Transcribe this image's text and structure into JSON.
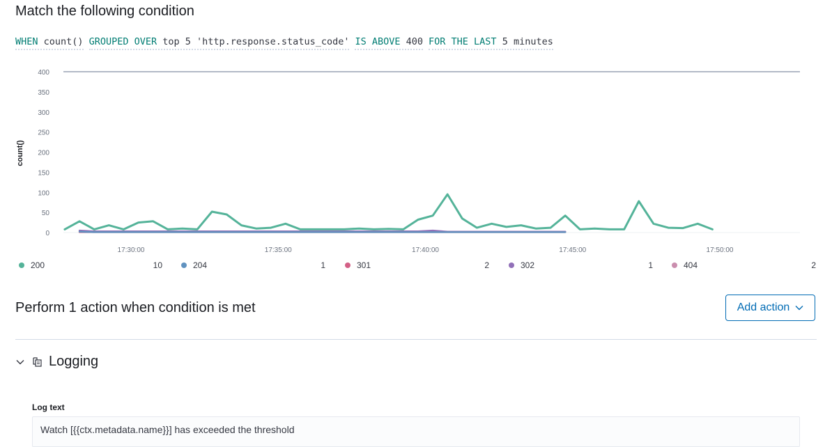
{
  "section_title": "Match the following condition",
  "expression": [
    {
      "keyword": "WHEN",
      "value": "count()"
    },
    {
      "keyword": "GROUPED OVER",
      "value": "top 5 'http.response.status_code'"
    },
    {
      "keyword": "IS ABOVE",
      "value": "400"
    },
    {
      "keyword": "FOR THE LAST",
      "value": "5 minutes"
    }
  ],
  "chart_data": {
    "type": "line",
    "ylabel": "count()",
    "xlabel": "",
    "ylim": [
      0,
      400
    ],
    "yticks": [
      "400",
      "350",
      "300",
      "250",
      "200",
      "150",
      "100",
      "50",
      "0"
    ],
    "xticks": [
      "17:30:00",
      "17:35:00",
      "17:40:00",
      "17:45:00",
      "17:50:00"
    ],
    "threshold": 400,
    "x": [
      "17:27:45",
      "17:28:15",
      "17:28:45",
      "17:29:15",
      "17:29:45",
      "17:30:15",
      "17:30:45",
      "17:31:15",
      "17:31:45",
      "17:32:15",
      "17:32:45",
      "17:33:15",
      "17:33:45",
      "17:34:15",
      "17:34:45",
      "17:35:15",
      "17:35:45",
      "17:36:15",
      "17:36:45",
      "17:37:15",
      "17:37:45",
      "17:38:15",
      "17:38:45",
      "17:39:15",
      "17:39:45",
      "17:40:15",
      "17:40:45",
      "17:41:15",
      "17:41:45",
      "17:42:15",
      "17:42:45",
      "17:43:15",
      "17:43:45",
      "17:44:15",
      "17:44:45",
      "17:45:15",
      "17:45:45",
      "17:46:15",
      "17:46:45",
      "17:47:15",
      "17:47:45",
      "17:48:15",
      "17:48:45",
      "17:49:15",
      "17:49:45",
      "17:50:15"
    ],
    "series": [
      {
        "name": "200",
        "color": "#54b399",
        "count": "10",
        "values": [
          8,
          28,
          8,
          18,
          8,
          25,
          28,
          8,
          10,
          8,
          52,
          45,
          18,
          10,
          12,
          22,
          8,
          8,
          8,
          8,
          10,
          8,
          9,
          8,
          32,
          42,
          95,
          35,
          12,
          22,
          14,
          18,
          10,
          12,
          42,
          8,
          10,
          8,
          8,
          78,
          22,
          12,
          11,
          22,
          8,
          null
        ]
      },
      {
        "name": "204",
        "color": "#6092c0",
        "count": "1",
        "values": [
          null,
          2,
          1,
          1,
          1,
          1,
          1,
          1,
          1,
          1,
          1,
          1,
          1,
          1,
          1,
          1,
          1,
          1,
          1,
          1,
          1,
          1,
          1,
          1,
          1,
          1,
          1,
          1,
          1,
          1,
          1,
          1,
          1,
          1,
          1,
          null,
          null,
          null,
          null,
          null,
          null,
          null,
          null,
          null,
          null,
          null
        ]
      },
      {
        "name": "301",
        "color": "#d36086",
        "count": "2",
        "values": [
          null,
          1,
          1,
          1,
          1,
          1,
          1,
          1,
          1,
          1,
          1,
          1,
          1,
          1,
          1,
          1,
          1,
          1,
          1,
          1,
          1,
          1,
          1,
          1,
          1,
          1,
          1,
          1,
          1,
          1,
          1,
          1,
          1,
          1,
          1,
          null,
          null,
          null,
          null,
          null,
          null,
          null,
          null,
          null,
          null,
          null
        ]
      },
      {
        "name": "302",
        "color": "#9170b8",
        "count": "1",
        "values": [
          null,
          5,
          3,
          3,
          3,
          3,
          3,
          3,
          3,
          3,
          3,
          3,
          3,
          3,
          3,
          3,
          3,
          3,
          3,
          3,
          3,
          3,
          3,
          3,
          3,
          5,
          2,
          2,
          2,
          2,
          2,
          2,
          2,
          2,
          2,
          null,
          null,
          null,
          null,
          null,
          null,
          null,
          null,
          null,
          null,
          null
        ]
      },
      {
        "name": "404",
        "color": "#ca8eae",
        "count": "2",
        "values": [
          null,
          2,
          2,
          2,
          2,
          2,
          2,
          2,
          2,
          2,
          2,
          2,
          2,
          2,
          2,
          2,
          2,
          2,
          2,
          2,
          2,
          2,
          2,
          2,
          2,
          2,
          2,
          2,
          2,
          2,
          2,
          2,
          2,
          2,
          2,
          null,
          null,
          null,
          null,
          null,
          null,
          null,
          null,
          null,
          null,
          null
        ]
      }
    ]
  },
  "actions_title": "Perform 1 action when condition is met",
  "add_action_label": "Add action",
  "logging": {
    "title": "Logging",
    "log_text_label": "Log text",
    "log_text_value": "Watch [{{ctx.metadata.name}}] has exceeded the threshold"
  },
  "icons": {
    "expand": "chevron-down-icon",
    "logging": "logging-icon",
    "add_action": "arrow-down-icon"
  },
  "colors": {
    "keyword": "#017d73",
    "primary": "#006bb4",
    "threshold_line": "#98a2b3"
  }
}
